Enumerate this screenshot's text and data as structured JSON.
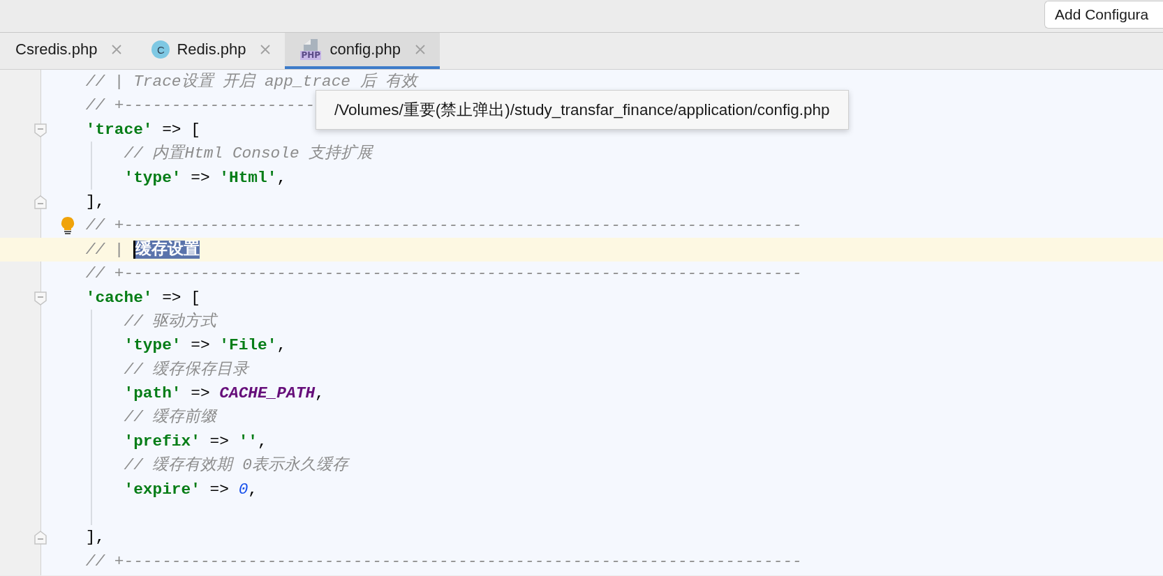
{
  "toolbar": {
    "add_configuration_button": "Add Configura"
  },
  "tabs": [
    {
      "label": "Csredis.php",
      "kind": "plain",
      "selected": false
    },
    {
      "label": "Redis.php",
      "kind": "class",
      "icon_text": "C",
      "selected": false
    },
    {
      "label": "config.php",
      "kind": "php",
      "icon_text": "PHP",
      "selected": true
    }
  ],
  "editor": {
    "lines": [
      {
        "segments": [
          {
            "text": "    // | Trace设置 开启 app_trace 后 有效",
            "kind": "comment"
          }
        ],
        "fold_start": false,
        "fold_end": false,
        "current": false,
        "bulb": false,
        "guide": false
      },
      {
        "segments": [
          {
            "text": "    // +--------------------",
            "kind": "comment"
          }
        ],
        "fold_start": false,
        "fold_end": false,
        "current": false,
        "bulb": false,
        "guide": false
      },
      {
        "segments": [
          {
            "text": "    'trace'",
            "kind": "key"
          },
          {
            "text": " => [",
            "kind": "plain"
          }
        ],
        "fold_start": true,
        "fold_end": false,
        "current": false,
        "bulb": false,
        "guide": false
      },
      {
        "segments": [
          {
            "text": "        // 内置Html Console 支持扩展",
            "kind": "comment"
          }
        ],
        "fold_start": false,
        "fold_end": false,
        "current": false,
        "bulb": false,
        "guide": true
      },
      {
        "segments": [
          {
            "text": "        'type'",
            "kind": "key"
          },
          {
            "text": " => ",
            "kind": "plain"
          },
          {
            "text": "'Html'",
            "kind": "key"
          },
          {
            "text": ",",
            "kind": "plain"
          }
        ],
        "fold_start": false,
        "fold_end": false,
        "current": false,
        "bulb": false,
        "guide": true
      },
      {
        "segments": [
          {
            "text": "    ],",
            "kind": "plain"
          }
        ],
        "fold_start": false,
        "fold_end": true,
        "current": false,
        "bulb": false,
        "guide": false
      },
      {
        "segments": [
          {
            "text": "    // +-----------------------------------------------------------------------",
            "kind": "comment"
          }
        ],
        "fold_start": false,
        "fold_end": false,
        "current": false,
        "bulb": true,
        "guide": false
      },
      {
        "segments": [
          {
            "text": "    // | ",
            "kind": "comment"
          },
          {
            "text": "缓存设置",
            "kind": "selected"
          }
        ],
        "fold_start": false,
        "fold_end": false,
        "current": true,
        "bulb": false,
        "guide": false
      },
      {
        "segments": [
          {
            "text": "    // +-----------------------------------------------------------------------",
            "kind": "comment"
          }
        ],
        "fold_start": false,
        "fold_end": false,
        "current": false,
        "bulb": false,
        "guide": false
      },
      {
        "segments": [
          {
            "text": "    'cache'",
            "kind": "key"
          },
          {
            "text": " => [",
            "kind": "plain"
          }
        ],
        "fold_start": true,
        "fold_end": false,
        "current": false,
        "bulb": false,
        "guide": false
      },
      {
        "segments": [
          {
            "text": "        // 驱动方式",
            "kind": "comment"
          }
        ],
        "fold_start": false,
        "fold_end": false,
        "current": false,
        "bulb": false,
        "guide": true
      },
      {
        "segments": [
          {
            "text": "        'type'",
            "kind": "key"
          },
          {
            "text": " => ",
            "kind": "plain"
          },
          {
            "text": "'File'",
            "kind": "key"
          },
          {
            "text": ",",
            "kind": "plain"
          }
        ],
        "fold_start": false,
        "fold_end": false,
        "current": false,
        "bulb": false,
        "guide": true
      },
      {
        "segments": [
          {
            "text": "        // 缓存保存目录",
            "kind": "comment"
          }
        ],
        "fold_start": false,
        "fold_end": false,
        "current": false,
        "bulb": false,
        "guide": true
      },
      {
        "segments": [
          {
            "text": "        'path'",
            "kind": "key"
          },
          {
            "text": " => ",
            "kind": "plain"
          },
          {
            "text": "CACHE_PATH",
            "kind": "constant"
          },
          {
            "text": ",",
            "kind": "plain"
          }
        ],
        "fold_start": false,
        "fold_end": false,
        "current": false,
        "bulb": false,
        "guide": true
      },
      {
        "segments": [
          {
            "text": "        // 缓存前缀",
            "kind": "comment"
          }
        ],
        "fold_start": false,
        "fold_end": false,
        "current": false,
        "bulb": false,
        "guide": true
      },
      {
        "segments": [
          {
            "text": "        'prefix'",
            "kind": "key"
          },
          {
            "text": " => ",
            "kind": "plain"
          },
          {
            "text": "''",
            "kind": "key"
          },
          {
            "text": ",",
            "kind": "plain"
          }
        ],
        "fold_start": false,
        "fold_end": false,
        "current": false,
        "bulb": false,
        "guide": true
      },
      {
        "segments": [
          {
            "text": "        // 缓存有效期 0表示永久缓存",
            "kind": "comment"
          }
        ],
        "fold_start": false,
        "fold_end": false,
        "current": false,
        "bulb": false,
        "guide": true
      },
      {
        "segments": [
          {
            "text": "        'expire'",
            "kind": "key"
          },
          {
            "text": " => ",
            "kind": "plain"
          },
          {
            "text": "0",
            "kind": "number"
          },
          {
            "text": ",",
            "kind": "plain"
          }
        ],
        "fold_start": false,
        "fold_end": false,
        "current": false,
        "bulb": false,
        "guide": true
      },
      {
        "fold_start": false,
        "fold_end": false,
        "current": false,
        "bulb": false,
        "guide": true
      },
      {
        "segments": [
          {
            "text": "    ],",
            "kind": "plain"
          }
        ],
        "fold_start": false,
        "fold_end": true,
        "current": false,
        "bulb": false,
        "guide": false
      },
      {
        "segments": [
          {
            "text": "    // +-----------------------------------------------------------------------",
            "kind": "comment"
          }
        ],
        "fold_start": false,
        "fold_end": false,
        "current": false,
        "bulb": false,
        "guide": false
      }
    ]
  },
  "tooltip": {
    "text": "/Volumes/重要(禁止弹出)/study_transfar_finance/application/config.php"
  }
}
